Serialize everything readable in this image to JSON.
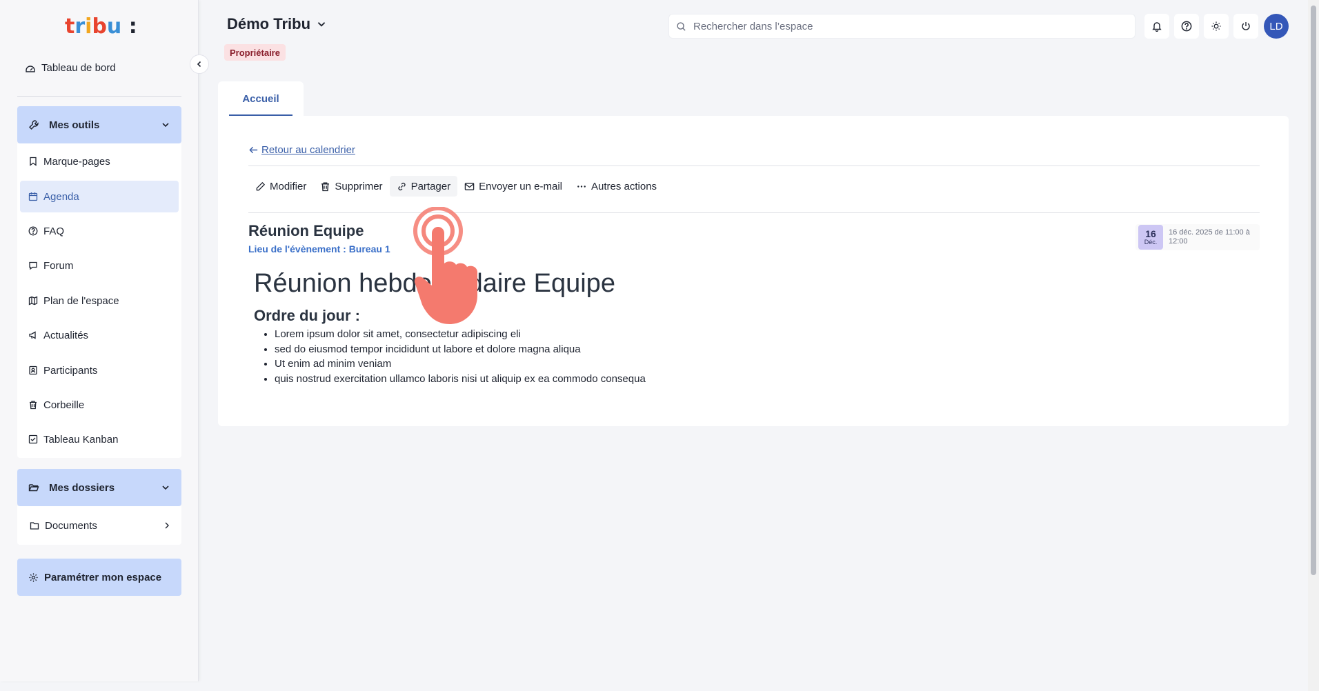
{
  "sidebar": {
    "logo_alt": "tribu",
    "dashboard_label": "Tableau de bord",
    "tools_group": {
      "label": "Mes outils",
      "items": [
        {
          "label": "Marque-pages",
          "icon": "bookmark-icon"
        },
        {
          "label": "Agenda",
          "icon": "calendar-icon",
          "active": true
        },
        {
          "label": "FAQ",
          "icon": "help-circle-icon"
        },
        {
          "label": "Forum",
          "icon": "chat-icon"
        },
        {
          "label": "Plan de l'espace",
          "icon": "map-icon"
        },
        {
          "label": "Actualités",
          "icon": "megaphone-icon"
        },
        {
          "label": "Participants",
          "icon": "contact-icon"
        },
        {
          "label": "Corbeille",
          "icon": "trash-icon"
        },
        {
          "label": "Tableau Kanban",
          "icon": "checkbox-icon"
        }
      ]
    },
    "folders_group": {
      "label": "Mes dossiers",
      "items": [
        {
          "label": "Documents",
          "icon": "folder-icon"
        }
      ]
    },
    "settings_label": "Paramétrer mon espace"
  },
  "header": {
    "space_title": "Démo Tribu",
    "role_badge": "Propriétaire",
    "search_placeholder": "Rechercher dans l’espace",
    "avatar_initials": "LD"
  },
  "tabs": [
    {
      "label": "Accueil",
      "active": true
    }
  ],
  "event": {
    "back_link": "Retour au calendrier",
    "actions": {
      "edit": "Modifier",
      "delete": "Supprimer",
      "share": "Partager",
      "email": "Envoyer un e-mail",
      "more": "Autres actions"
    },
    "title": "Réunion Equipe",
    "location": "Lieu de l'évènement : Bureau 1",
    "date_day": "16",
    "date_month": "Déc.",
    "date_text": "16 déc. 2025 de 11:00 à 12:00",
    "body_heading": "Réunion hebdomadaire Equipe",
    "body_subheading": "Ordre du jour :",
    "body_list": [
      "Lorem ipsum dolor sit amet, consectetur adipiscing eli",
      "sed do eiusmod tempor incididunt ut labore et dolore magna aliqua",
      "Ut enim ad minim veniam",
      "quis nostrud exercitation ullamco laboris nisi ut aliquip ex ea commodo consequa"
    ]
  },
  "colors": {
    "accent": "#3a5fa8",
    "group_bg": "#c7d8fb",
    "avatar_bg": "#3457b8",
    "badge_bg": "#fbe1e3",
    "cursor_overlay": "#f47a6e"
  }
}
